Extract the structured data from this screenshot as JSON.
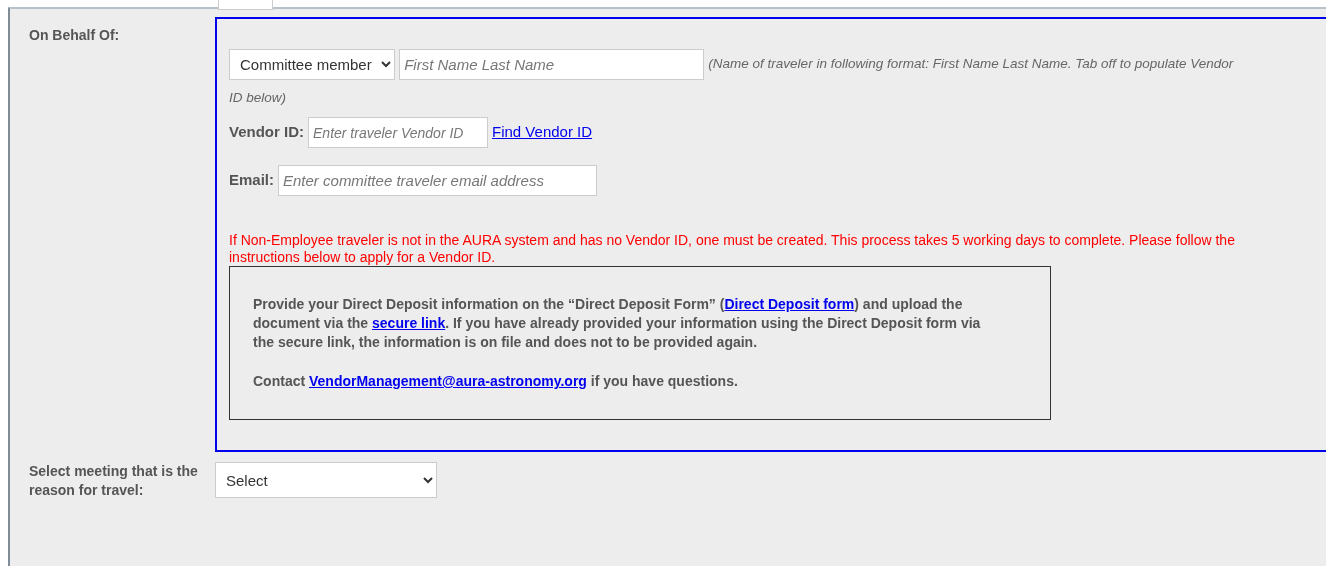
{
  "on_behalf_of": {
    "label": "On Behalf Of:",
    "traveler_type": {
      "value": "Committee member"
    },
    "name_field": {
      "placeholder": "First Name Last Name"
    },
    "name_hint": [
      "(Name of traveler in following format: First Name Last Name. Tab off to populate Vendor",
      "ID below)"
    ],
    "vendor_id": {
      "label": "Vendor ID:",
      "placeholder": "Enter traveler Vendor ID",
      "link": "Find Vendor ID"
    },
    "email": {
      "label": "Email:",
      "placeholder": "Enter committee traveler email address"
    },
    "warning": "If Non-Employee traveler is not in the AURA system and has no Vendor ID, one must be created. This process takes 5 working days to complete. Please follow the instructions below to apply for a Vendor ID.",
    "instructions": [
      [
        {
          "kind": "text",
          "text": "Provide your Direct Deposit information on the “Direct Deposit Form” ("
        },
        {
          "kind": "link",
          "text": "Direct Deposit form"
        },
        {
          "kind": "text",
          "text": ") and upload the document via the "
        },
        {
          "kind": "link",
          "text": "secure link"
        },
        {
          "kind": "text",
          "text": ". If you have already provided your information using the Direct Deposit form via the secure link, the information is on file and does not to be provided again."
        }
      ],
      [
        {
          "kind": "text",
          "text": "Contact "
        },
        {
          "kind": "link",
          "text": "VendorManagement@aura-astronomy.org"
        },
        {
          "kind": "text",
          "text": " if you have questions."
        }
      ]
    ]
  },
  "meeting": {
    "label": "Select meeting that is the reason for travel:",
    "value": "Select"
  }
}
